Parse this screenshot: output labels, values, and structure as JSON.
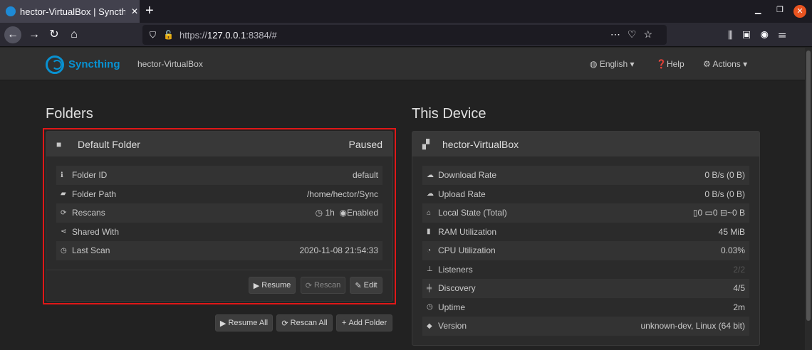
{
  "browser": {
    "tab_title": "hector-VirtualBox | Syncthing",
    "new_tab": "+",
    "tab_close": "✕",
    "url_prefix": "https://",
    "url_host": "127.0.0.1",
    "url_rest": ":8384/#"
  },
  "header": {
    "brand": "Syncthing",
    "device": "hector-VirtualBox",
    "language": "English",
    "help": "Help",
    "actions": "Actions"
  },
  "folders": {
    "title": "Folders",
    "folder_name": "Default Folder",
    "status": "Paused",
    "rows": [
      {
        "label": "Folder ID",
        "value": "default",
        "icon": "info-icon"
      },
      {
        "label": "Folder Path",
        "value": "/home/hector/Sync",
        "icon": "folder-open-icon"
      },
      {
        "label": "Rescans",
        "value_interval": "1h",
        "value_watch": "Enabled",
        "icon": "refresh-icon"
      },
      {
        "label": "Shared With",
        "value": "",
        "icon": "share-icon"
      },
      {
        "label": "Last Scan",
        "value": "2020-11-08 21:54:33",
        "icon": "clock-icon"
      }
    ],
    "buttons": {
      "resume": "Resume",
      "rescan": "Rescan",
      "edit": "Edit"
    },
    "bottom_buttons": {
      "resume_all": "Resume All",
      "rescan_all": "Rescan All",
      "add_folder": "Add Folder"
    }
  },
  "device": {
    "title": "This Device",
    "name": "hector-VirtualBox",
    "rows": [
      {
        "label": "Download Rate",
        "value": "0 B/s (0 B)",
        "icon": "cloud-download-icon"
      },
      {
        "label": "Upload Rate",
        "value": "0 B/s (0 B)",
        "icon": "cloud-upload-icon"
      },
      {
        "label": "Local State (Total)",
        "value_files": "0",
        "value_dirs": "0",
        "value_size": "~0 B",
        "icon": "home-icon"
      },
      {
        "label": "RAM Utilization",
        "value": "45 MiB",
        "icon": "memory-icon"
      },
      {
        "label": "CPU Utilization",
        "value": "0.03%",
        "icon": "tachometer-icon"
      },
      {
        "label": "Listeners",
        "value": "2/2",
        "icon": "sitemap-icon"
      },
      {
        "label": "Discovery",
        "value": "4/5",
        "icon": "signpost-icon"
      },
      {
        "label": "Uptime",
        "value": "2m",
        "icon": "clock-icon"
      },
      {
        "label": "Version",
        "value": "unknown-dev, Linux (64 bit)",
        "icon": "tag-icon"
      }
    ]
  }
}
